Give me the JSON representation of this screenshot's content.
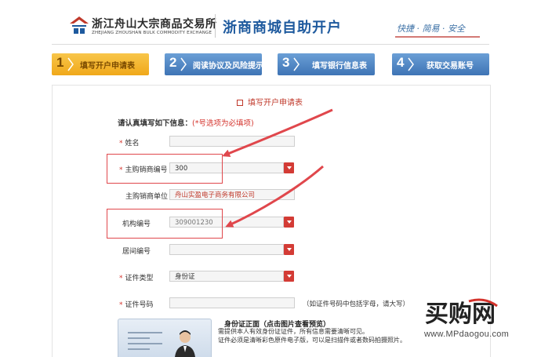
{
  "header": {
    "org_name_cn": "浙江舟山大宗商品交易所",
    "org_name_en": "ZHEJIANG ZHOUSHAN BULK COMMODITY EXCHANGE",
    "system_title": "浙商商城自助开户",
    "slogan": "快捷 · 简易 · 安全"
  },
  "steps": [
    {
      "num": "1",
      "label": "填写开户申请表",
      "active": true
    },
    {
      "num": "2",
      "label": "阅读协议及风险提示",
      "active": false
    },
    {
      "num": "3",
      "label": "填写银行信息表",
      "active": false
    },
    {
      "num": "4",
      "label": "获取交易账号",
      "active": false
    }
  ],
  "form": {
    "title": "填写开户申请表",
    "note_prefix": "请认真填写如下信息：",
    "note_required": "(*号选项为必填项)",
    "fields": {
      "name": {
        "label": "姓名",
        "required": true,
        "value": ""
      },
      "dealer_code": {
        "label": "主购销商编号",
        "required": true,
        "value": "300"
      },
      "dealer_unit": {
        "label": "主购销商单位",
        "required": false,
        "value": "舟山实盈电子商务有限公司"
      },
      "org_code": {
        "label": "机构编号",
        "required": false,
        "value": "309001230"
      },
      "broker_code": {
        "label": "居间编号",
        "required": false,
        "value": ""
      },
      "id_type": {
        "label": "证件类型",
        "required": true,
        "value": "身份证"
      },
      "id_number": {
        "label": "证件号码",
        "required": true,
        "value": "",
        "hint": "（如证件号码中包括字母，请大写）"
      }
    },
    "id_front": {
      "heading": "身份证正面（点击图片查看预览）",
      "line1": "需提供本人有效身份证证件，所有信息需要清晰可见。",
      "line2": "证件必须是清晰彩色原件电子版，可以是扫描件或者数码拍摄照片。"
    }
  },
  "watermark": {
    "brand": "买购网",
    "url": "www.MPdaogou.com"
  },
  "colors": {
    "accent_blue": "#1e5a9e",
    "step_active": "#f0a81a",
    "step_idle": "#3e74b5",
    "required_red": "#d4332c",
    "annotation_red": "#e0474c"
  }
}
